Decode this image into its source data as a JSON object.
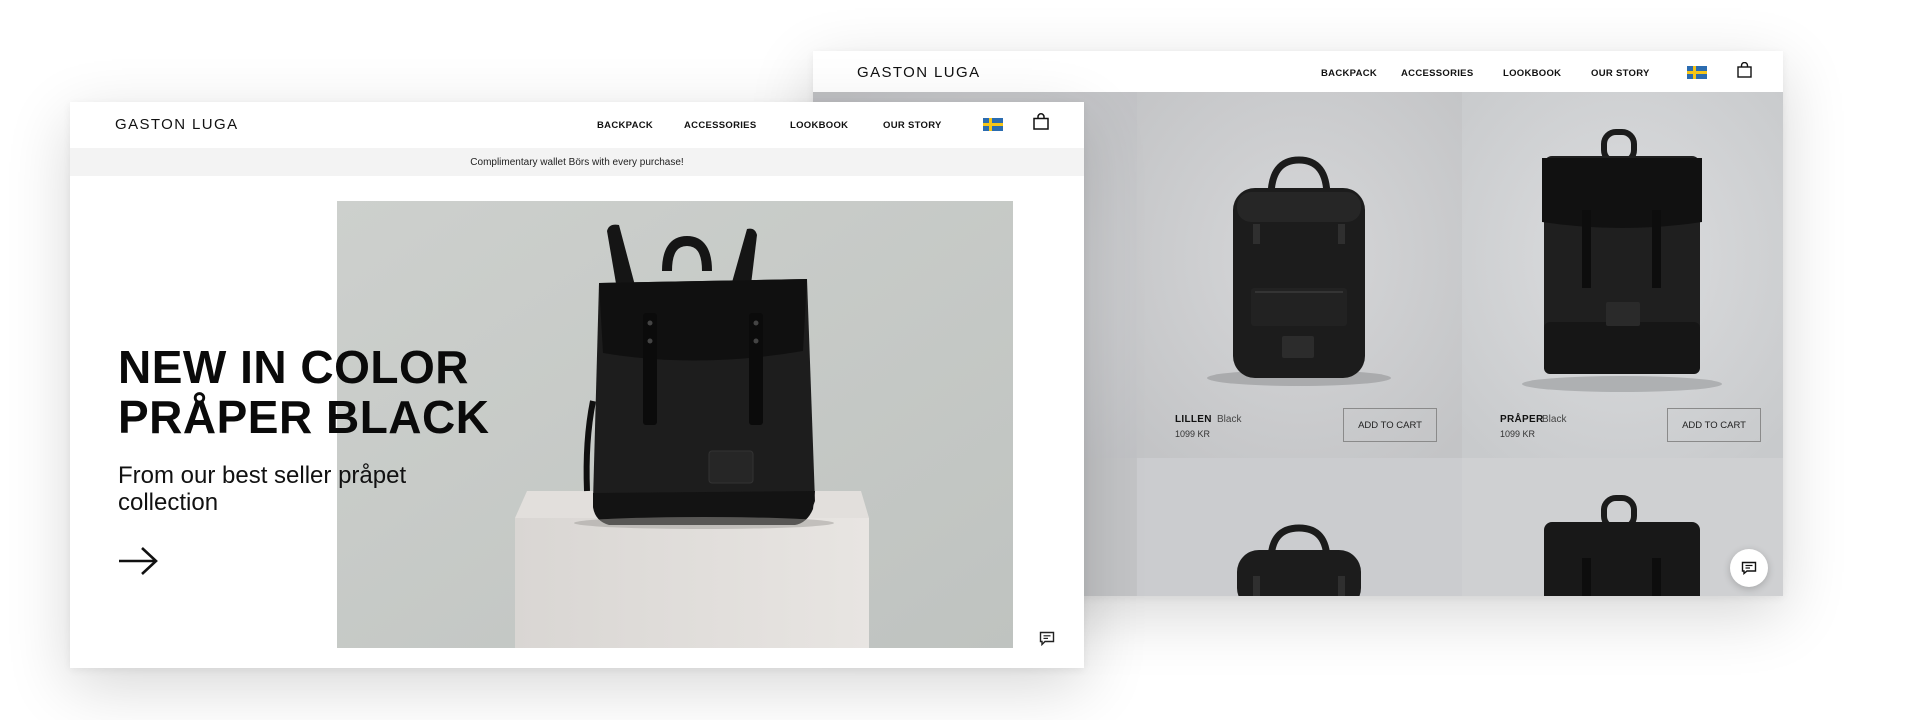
{
  "back_window": {
    "brand": "GASTON LUGA",
    "nav": [
      "BACKPACK",
      "ACCESSORIES",
      "LOOKBOOK",
      "OUR STORY"
    ],
    "partial_button_label": "RT",
    "products": [
      {
        "name": "LILLEN",
        "color": "Black",
        "price": "1099 KR",
        "button": "ADD TO CART"
      },
      {
        "name": "PRÅPER",
        "color": "Black",
        "price": "1099 KR",
        "button": "ADD TO CART"
      }
    ]
  },
  "front_window": {
    "brand": "GASTON LUGA",
    "nav": [
      "BACKPACK",
      "ACCESSORIES",
      "LOOKBOOK",
      "OUR STORY"
    ],
    "promo": "Complimentary wallet Börs with every purchase!",
    "headline_line1": "NEW IN COLOR",
    "headline_line2": "PRÅPER BLACK",
    "subline": "From our best seller pråpet collection"
  },
  "icons": {
    "flag": "sweden-flag-icon",
    "cart": "shopping-bag-icon",
    "chat": "chat-icon",
    "arrow": "arrow-right-icon"
  },
  "colors": {
    "flag_blue": "#2b6cb0",
    "flag_yellow": "#f5c518",
    "hero_background": "#c8cbc8"
  }
}
